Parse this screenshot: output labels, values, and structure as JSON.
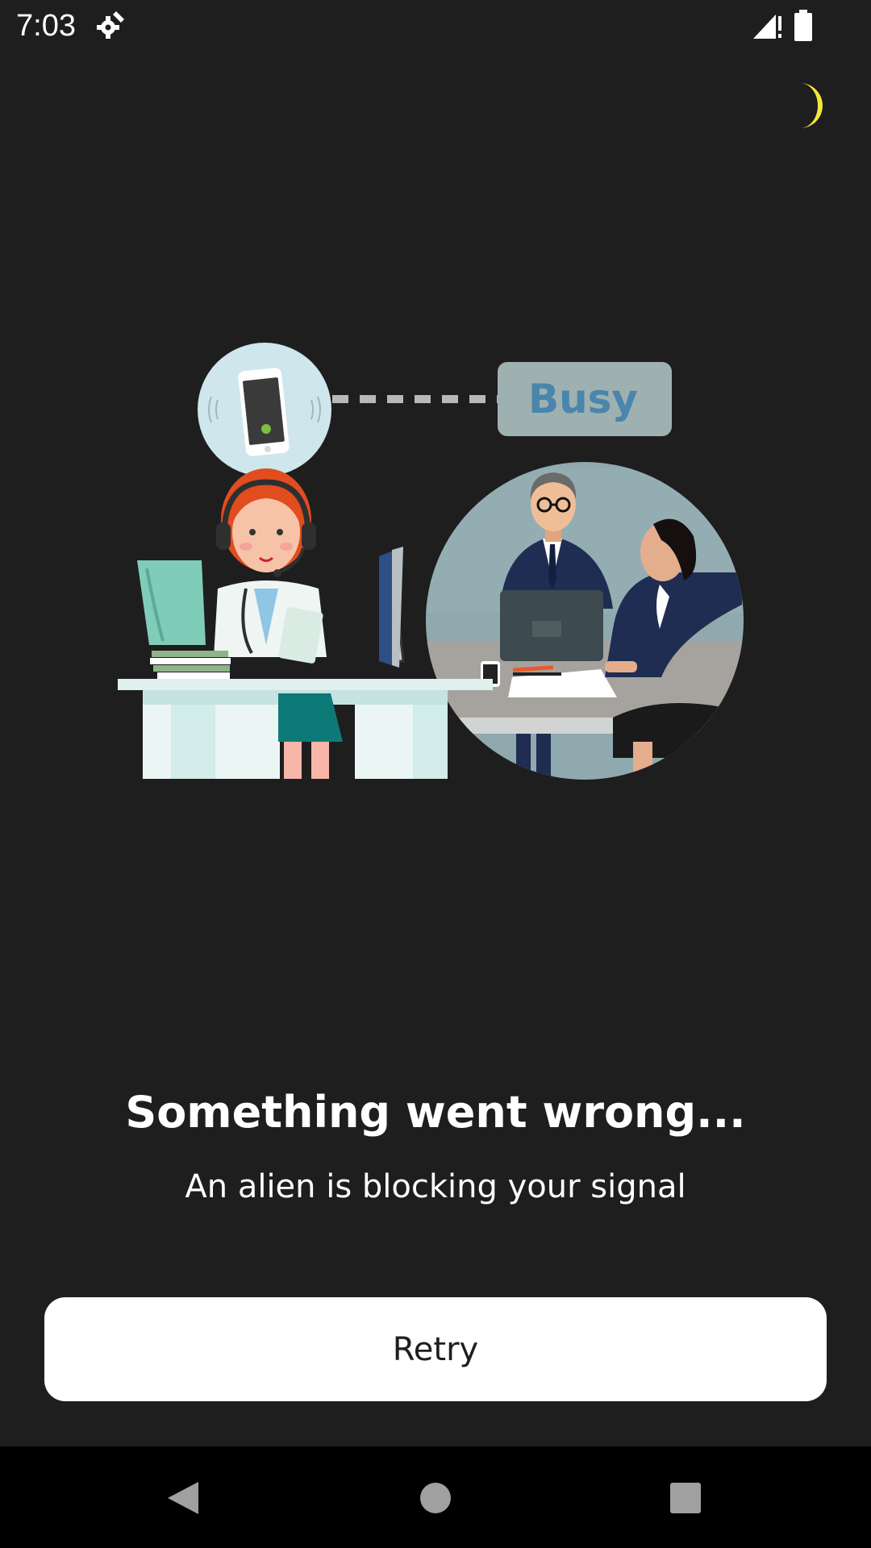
{
  "status_bar": {
    "time": "7:03",
    "icons": [
      "settings-gear-icon",
      "cellular-signal-alert-icon",
      "battery-icon"
    ]
  },
  "theme_toggle": {
    "icon": "moon-icon",
    "color": "#f2e838"
  },
  "illustration": {
    "busy_label": "Busy",
    "icons": [
      "phone-call-icon",
      "receptionist-illustration",
      "meeting-illustration"
    ]
  },
  "error": {
    "title": "Something went wrong...",
    "message": "An alien is blocking your signal"
  },
  "retry": {
    "label": "Retry"
  },
  "nav_bar": {
    "icons": [
      "back-icon",
      "home-icon",
      "recents-icon"
    ]
  },
  "colors": {
    "background": "#1e1e1f",
    "button_bg": "#ffffff",
    "accent": "#f2e838"
  }
}
